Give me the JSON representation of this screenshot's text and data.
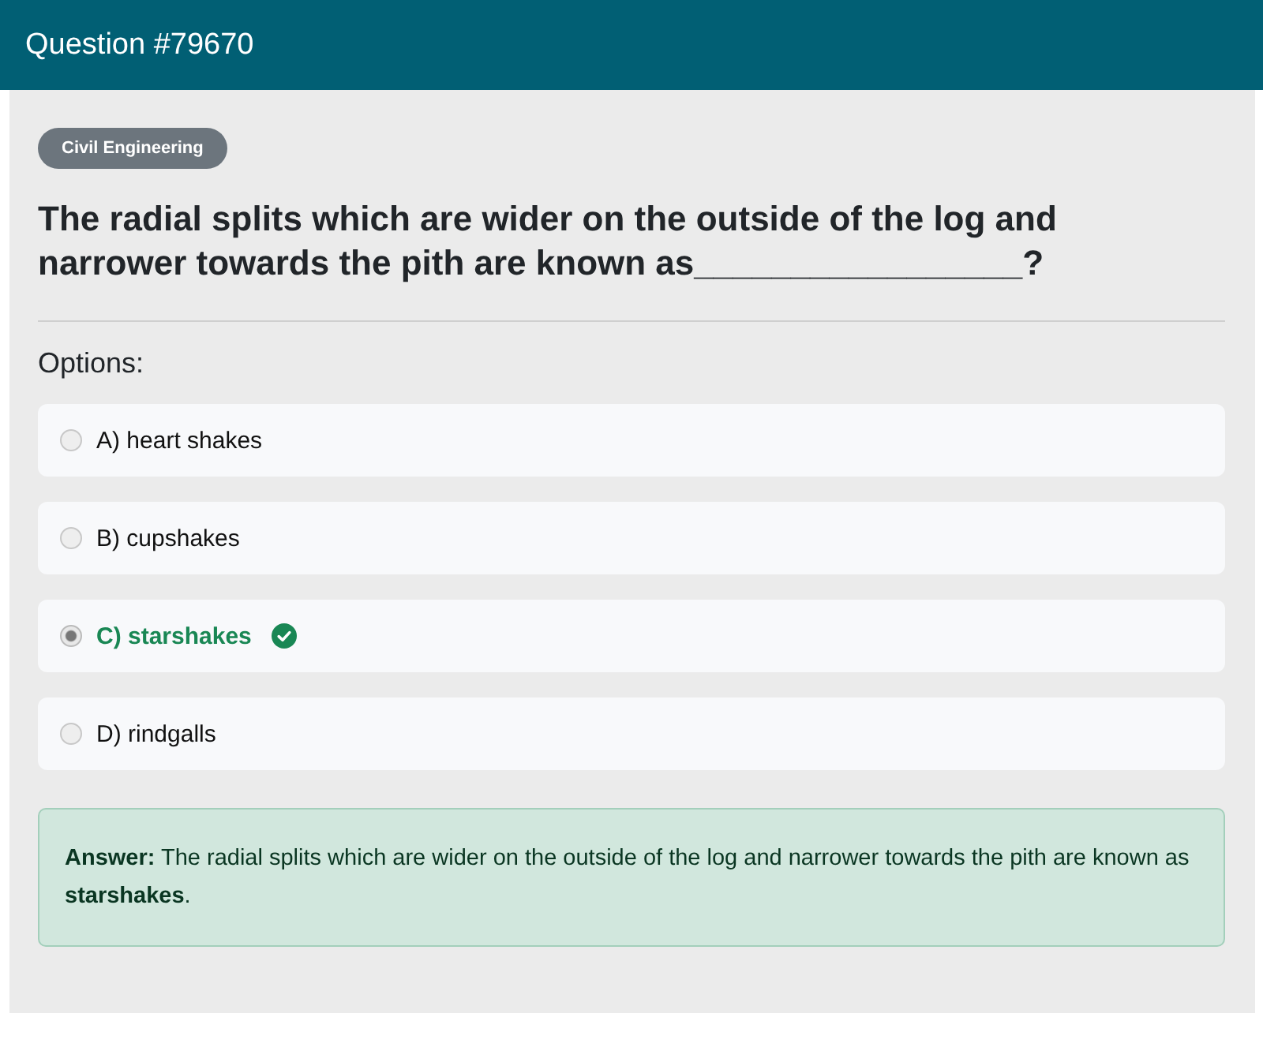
{
  "header": {
    "title": "Question #79670"
  },
  "category": "Civil Engineering",
  "question": "The radial splits which are wider on the outside of the log and narrower towards the pith are known as_________________?",
  "options_label": "Options:",
  "options": [
    {
      "label": "A) heart shakes",
      "selected": false,
      "correct": false
    },
    {
      "label": "B) cupshakes",
      "selected": false,
      "correct": false
    },
    {
      "label": "C) starshakes",
      "selected": true,
      "correct": true
    },
    {
      "label": "D) rindgalls",
      "selected": false,
      "correct": false
    }
  ],
  "answer": "**Answer:** The radial splits which are wider on the outside of the log and narrower towards the pith are known as **starshakes**."
}
